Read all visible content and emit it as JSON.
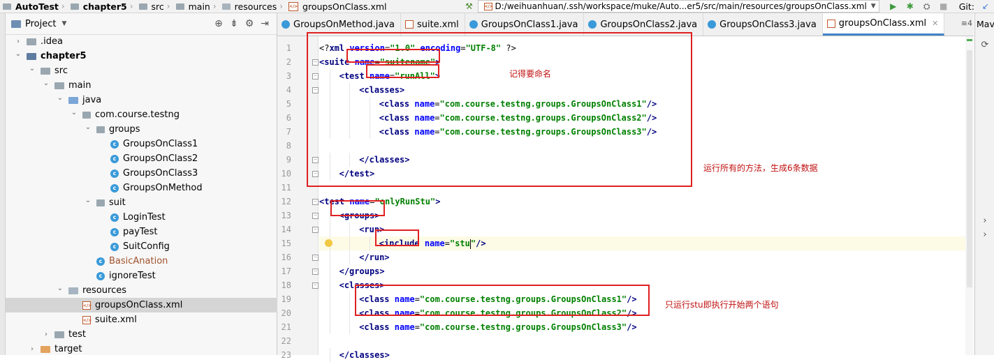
{
  "navbar": {
    "crumbs": [
      "AutoTest",
      "chapter5",
      "src",
      "main",
      "resources",
      "groupsOnClass.xml"
    ],
    "run_config_path": "D:/weihuanhuan/.ssh/workspace/muke/Auto...er5/src/main/resources/groupsOnClass.xml",
    "git_label": "Git:",
    "icons": [
      "hammer-icon",
      "run-icon",
      "debug-icon",
      "coverage-icon",
      "stop-icon"
    ]
  },
  "project": {
    "title": "Project",
    "tree": [
      {
        "label": "AutoTest",
        "depth": 1,
        "icon": "folder",
        "arrow": "closed",
        "hidden": true
      },
      {
        "label": ".idea",
        "depth": 1,
        "icon": "folder",
        "arrow": "closed"
      },
      {
        "label": "chapter5",
        "depth": 1,
        "icon": "module",
        "arrow": "open",
        "bold": true
      },
      {
        "label": "src",
        "depth": 2,
        "icon": "folder",
        "arrow": "open"
      },
      {
        "label": "main",
        "depth": 3,
        "icon": "folder",
        "arrow": "open"
      },
      {
        "label": "java",
        "depth": 4,
        "icon": "source-folder",
        "arrow": "open"
      },
      {
        "label": "com.course.testng",
        "depth": 5,
        "icon": "package",
        "arrow": "open"
      },
      {
        "label": "groups",
        "depth": 6,
        "icon": "package",
        "arrow": "open"
      },
      {
        "label": "GroupsOnClass1",
        "depth": 7,
        "icon": "class",
        "arrow": "none"
      },
      {
        "label": "GroupsOnClass2",
        "depth": 7,
        "icon": "class",
        "arrow": "none"
      },
      {
        "label": "GroupsOnClass3",
        "depth": 7,
        "icon": "class",
        "arrow": "none"
      },
      {
        "label": "GroupsOnMethod",
        "depth": 7,
        "icon": "class",
        "arrow": "none"
      },
      {
        "label": "suit",
        "depth": 6,
        "icon": "package",
        "arrow": "open"
      },
      {
        "label": "LoginTest",
        "depth": 7,
        "icon": "class",
        "arrow": "none"
      },
      {
        "label": "payTest",
        "depth": 7,
        "icon": "class",
        "arrow": "none"
      },
      {
        "label": "SuitConfig",
        "depth": 7,
        "icon": "class",
        "arrow": "none"
      },
      {
        "label": "BasicAnation",
        "depth": 6,
        "icon": "class",
        "arrow": "none",
        "brown": true
      },
      {
        "label": "ignoreTest",
        "depth": 6,
        "icon": "class",
        "arrow": "none"
      },
      {
        "label": "resources",
        "depth": 4,
        "icon": "resources",
        "arrow": "open"
      },
      {
        "label": "groupsOnClass.xml",
        "depth": 5,
        "icon": "xml",
        "arrow": "none",
        "selected": true
      },
      {
        "label": "suite.xml",
        "depth": 5,
        "icon": "xml",
        "arrow": "none"
      },
      {
        "label": "test",
        "depth": 3,
        "icon": "folder",
        "arrow": "closed"
      },
      {
        "label": "target",
        "depth": 2,
        "icon": "target",
        "arrow": "closed"
      }
    ]
  },
  "editor": {
    "tabs": [
      {
        "label": "GroupsOnMethod.java",
        "icon": "cls"
      },
      {
        "label": "suite.xml",
        "icon": "xml"
      },
      {
        "label": "GroupsOnClass1.java",
        "icon": "cls"
      },
      {
        "label": "GroupsOnClass2.java",
        "icon": "cls"
      },
      {
        "label": "GroupsOnClass3.java",
        "icon": "cls"
      },
      {
        "label": "groupsOnClass.xml",
        "icon": "xml",
        "active": true
      }
    ],
    "tabs_overflow": "≡4",
    "lines": [
      {
        "n": "1",
        "indent": 0,
        "parts": [
          [
            "pl",
            "<?"
          ],
          [
            "t",
            "xml "
          ],
          [
            "an",
            "version"
          ],
          [
            "pl",
            "="
          ],
          [
            "av",
            "\"1.0\""
          ],
          [
            "pl",
            " "
          ],
          [
            "an",
            "encoding"
          ],
          [
            "pl",
            "="
          ],
          [
            "av",
            "\"UTF-8\""
          ],
          [
            "pl",
            " ?>"
          ]
        ]
      },
      {
        "n": "2",
        "indent": 0,
        "parts": [
          [
            "t",
            "<suite"
          ],
          [
            "pl",
            " "
          ],
          [
            "an",
            "name"
          ],
          [
            "pl",
            "="
          ],
          [
            "av",
            "\"suitename\""
          ],
          [
            "t",
            ">"
          ]
        ]
      },
      {
        "n": "3",
        "indent": 1,
        "parts": [
          [
            "t",
            "<test"
          ],
          [
            "pl",
            " "
          ],
          [
            "an",
            "name"
          ],
          [
            "pl",
            "="
          ],
          [
            "av",
            "\"runAll\""
          ],
          [
            "t",
            ">"
          ]
        ]
      },
      {
        "n": "4",
        "indent": 2,
        "parts": [
          [
            "t",
            "<classes>"
          ]
        ]
      },
      {
        "n": "5",
        "indent": 3,
        "parts": [
          [
            "t",
            "<class"
          ],
          [
            "pl",
            " "
          ],
          [
            "an",
            "name"
          ],
          [
            "pl",
            "="
          ],
          [
            "av",
            "\"com.course.testng.groups.GroupsOnClass1\""
          ],
          [
            "t",
            "/>"
          ]
        ]
      },
      {
        "n": "6",
        "indent": 3,
        "parts": [
          [
            "t",
            "<class"
          ],
          [
            "pl",
            " "
          ],
          [
            "an",
            "name"
          ],
          [
            "pl",
            "="
          ],
          [
            "av",
            "\"com.course.testng.groups.GroupsOnClass2\""
          ],
          [
            "t",
            "/>"
          ]
        ]
      },
      {
        "n": "7",
        "indent": 3,
        "parts": [
          [
            "t",
            "<class"
          ],
          [
            "pl",
            " "
          ],
          [
            "an",
            "name"
          ],
          [
            "pl",
            "="
          ],
          [
            "av",
            "\"com.course.testng.groups.GroupsOnClass3\""
          ],
          [
            "t",
            "/>"
          ]
        ]
      },
      {
        "n": "8",
        "indent": 0,
        "parts": []
      },
      {
        "n": "9",
        "indent": 2,
        "parts": [
          [
            "t",
            "</classes>"
          ]
        ]
      },
      {
        "n": "10",
        "indent": 1,
        "parts": [
          [
            "t",
            "</test>"
          ]
        ]
      },
      {
        "n": "11",
        "indent": 0,
        "parts": []
      },
      {
        "n": "12",
        "indent": 0,
        "parts": [
          [
            "t",
            "<test"
          ],
          [
            "pl",
            " "
          ],
          [
            "an",
            "name"
          ],
          [
            "pl",
            "="
          ],
          [
            "av",
            "\"onlyRunStu\""
          ],
          [
            "t",
            ">"
          ]
        ]
      },
      {
        "n": "13",
        "indent": 1,
        "parts": [
          [
            "t",
            "<groups>"
          ]
        ]
      },
      {
        "n": "14",
        "indent": 2,
        "parts": [
          [
            "t",
            "<run>"
          ]
        ]
      },
      {
        "n": "15",
        "indent": 3,
        "parts": [
          [
            "t",
            "<include"
          ],
          [
            "pl",
            " "
          ],
          [
            "an",
            "name"
          ],
          [
            "pl",
            "="
          ],
          [
            "av",
            "\"stu"
          ],
          [
            "caret",
            ""
          ],
          [
            "av",
            "\""
          ],
          [
            "t",
            "/>"
          ]
        ]
      },
      {
        "n": "16",
        "indent": 2,
        "parts": [
          [
            "t",
            "</run>"
          ]
        ]
      },
      {
        "n": "17",
        "indent": 1,
        "parts": [
          [
            "t",
            "</groups>"
          ]
        ]
      },
      {
        "n": "18",
        "indent": 1,
        "parts": [
          [
            "t",
            "<classes>"
          ]
        ]
      },
      {
        "n": "19",
        "indent": 2,
        "parts": [
          [
            "t",
            "<class"
          ],
          [
            "pl",
            " "
          ],
          [
            "an",
            "name"
          ],
          [
            "pl",
            "="
          ],
          [
            "av",
            "\"com.course.testng.groups.GroupsOnClass1\""
          ],
          [
            "t",
            "/>"
          ]
        ]
      },
      {
        "n": "20",
        "indent": 2,
        "parts": [
          [
            "t",
            "<class"
          ],
          [
            "pl",
            " "
          ],
          [
            "an",
            "name"
          ],
          [
            "pl",
            "="
          ],
          [
            "av",
            "\"com.course.testng.groups.GroupsOnClass2\""
          ],
          [
            "t",
            "/>"
          ]
        ]
      },
      {
        "n": "21",
        "indent": 2,
        "parts": [
          [
            "t",
            "<class"
          ],
          [
            "pl",
            " "
          ],
          [
            "an",
            "name"
          ],
          [
            "pl",
            "="
          ],
          [
            "av",
            "\"com.course.testng.groups.GroupsOnClass3\""
          ],
          [
            "t",
            "/>"
          ]
        ]
      },
      {
        "n": "22",
        "indent": 0,
        "parts": []
      },
      {
        "n": "23",
        "indent": 1,
        "parts": [
          [
            "t",
            "</classes>"
          ]
        ]
      }
    ],
    "caret_line": "15"
  },
  "annotations": {
    "name_note": "记得要命名",
    "run_all_note": "运行所有的方法，生成6条数据",
    "stu_note": "只运行stu即执行开始两个语句",
    "annotation_color": "#e02020"
  },
  "maven": {
    "label": "Mave"
  }
}
